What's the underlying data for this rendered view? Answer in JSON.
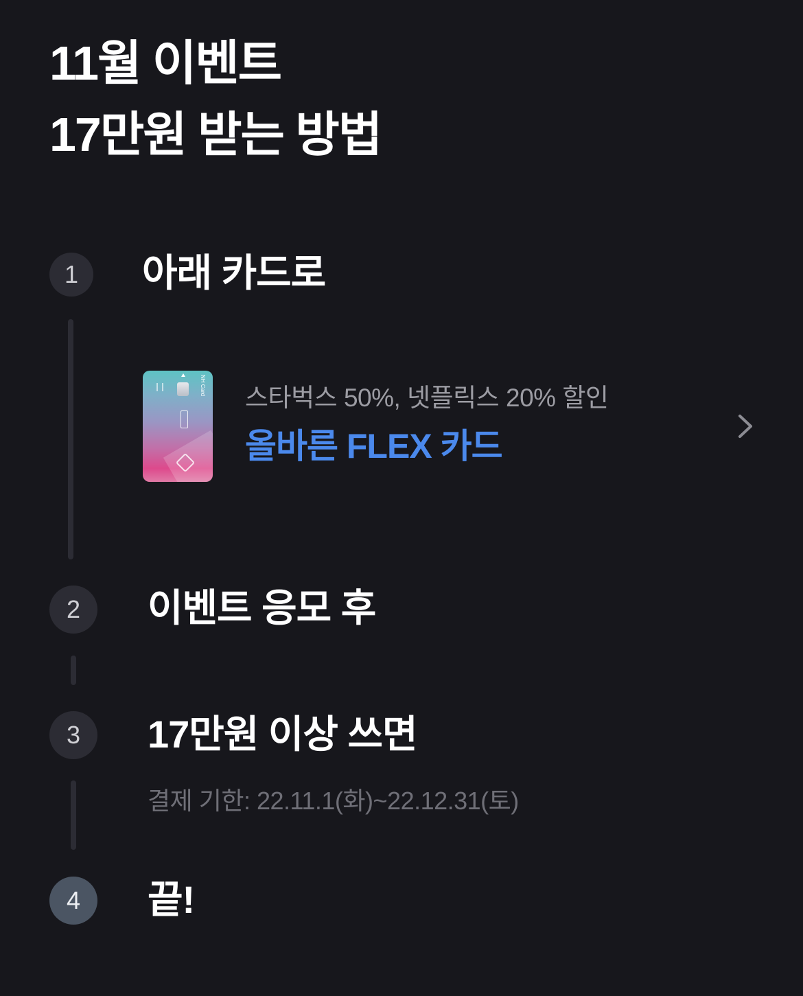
{
  "colors": {
    "background": "#17171c",
    "circle": "#2c2c34",
    "circle_last": "#4b5563",
    "line": "#2c2c34",
    "accent": "#4b89ec",
    "muted": "#9c9ca3",
    "dim": "#6f6f77"
  },
  "header": {
    "title_line1": "11월 이벤트",
    "title_line2": "17만원 받는 방법"
  },
  "steps": [
    {
      "number": "1",
      "label": "아래 카드로"
    },
    {
      "number": "2",
      "label": "이벤트 응모 후"
    },
    {
      "number": "3",
      "label": "17만원 이상 쓰면",
      "note": "결제 기한: 22.11.1(화)~22.12.31(토)"
    },
    {
      "number": "4",
      "label": "끝!"
    }
  ],
  "card": {
    "subtitle": "스타벅스 50%, 넷플릭스 20% 할인",
    "name": "올바른 FLEX 카드",
    "brand": "NH Card",
    "image_icon": "credit-card-image",
    "chevron_icon": "chevron-right-icon"
  }
}
